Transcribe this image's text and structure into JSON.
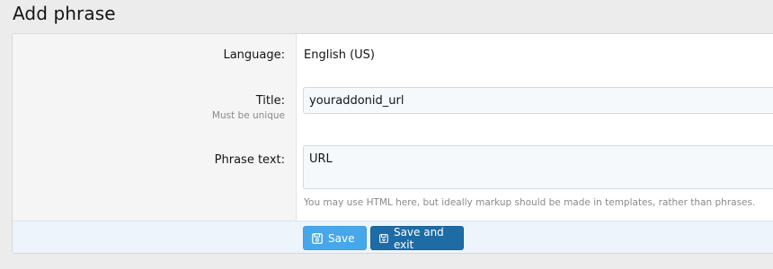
{
  "page": {
    "title": "Add phrase"
  },
  "form": {
    "language": {
      "label": "Language:",
      "value": "English (US)"
    },
    "title": {
      "label": "Title:",
      "hint": "Must be unique",
      "value": "youraddonid_url"
    },
    "phrase_text": {
      "label": "Phrase text:",
      "value": "URL",
      "explain": "You may use HTML here, but ideally markup should be made in templates, rather than phrases."
    }
  },
  "buttons": {
    "save": {
      "label": "Save",
      "icon": "save-icon"
    },
    "save_exit": {
      "label": "Save and exit",
      "icon": "save-icon"
    }
  }
}
